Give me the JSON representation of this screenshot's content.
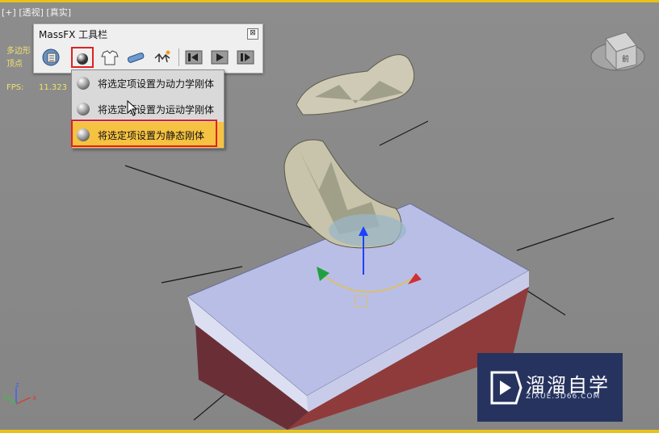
{
  "viewport": {
    "label_plus": "[+]",
    "label_view": "[透视]",
    "label_shading": "[真实]",
    "stats": {
      "polygons_label": "多边形",
      "vertices_label": "顶点",
      "fps_label": "FPS:",
      "fps_value": "11.323"
    },
    "viewcube_face": "前"
  },
  "toolbar": {
    "title": "MassFX 工具栏",
    "close": "⊠",
    "buttons": [
      {
        "icon": "world-settings-icon"
      },
      {
        "icon": "rigid-body-icon",
        "selected": true
      },
      {
        "icon": "cloth-icon"
      },
      {
        "icon": "constraint-icon"
      },
      {
        "icon": "ragdoll-icon"
      },
      {
        "icon": "reset-simulation-icon"
      },
      {
        "icon": "play-simulation-icon"
      },
      {
        "icon": "step-simulation-icon"
      }
    ]
  },
  "flyout": {
    "items": [
      {
        "label": "将选定项设置为动力学刚体"
      },
      {
        "label": "将选定项设置为运动学刚体"
      },
      {
        "label": "将选定项设置为静态刚体",
        "active": true
      }
    ]
  },
  "gizmo": {
    "axis_z": "z",
    "axis_x": "x",
    "axis_y": "y"
  },
  "watermark": {
    "title": "溜溜自学",
    "url": "ZIXUE.3D66.COM"
  },
  "colors": {
    "viewport_border": "#e8c21a",
    "highlight_red": "#e02020",
    "menu_active": "#f5c242",
    "box_top": "#b9bee6",
    "box_side": "#8a3a3a"
  }
}
